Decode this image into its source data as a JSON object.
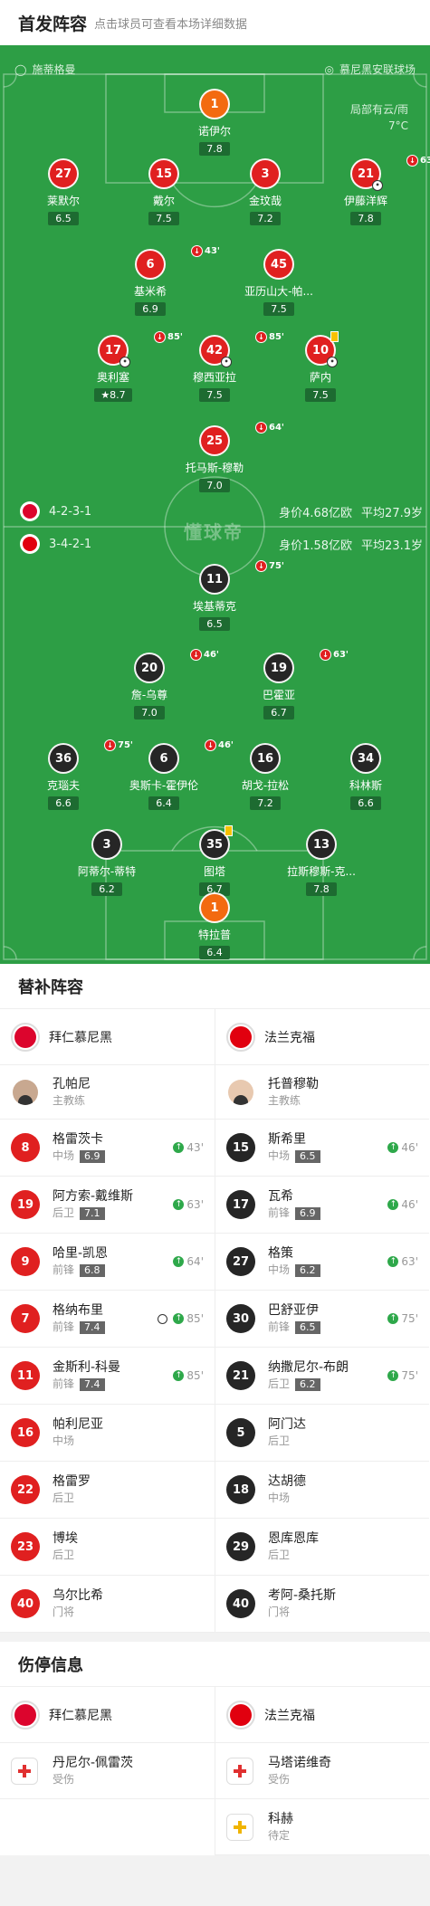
{
  "header": {
    "title": "首发阵容",
    "subtitle": "点击球员可查看本场详细数据"
  },
  "pitch": {
    "home_venue": "施蒂格曼",
    "away_venue": "慕尼黑安联球场",
    "weather": [
      "局部有云/雨",
      "7°C"
    ],
    "watermark": "懂球帝",
    "home": {
      "formation": "4-2-3-1",
      "value": "身价4.68亿欧",
      "age": "平均27.9岁",
      "color": "#dc052d"
    },
    "away": {
      "formation": "3-4-2-1",
      "value": "身价1.58亿欧",
      "age": "平均23.1岁",
      "color": "#e1000f"
    },
    "players": [
      {
        "num": "1",
        "name": "诺伊尔",
        "rating": "7.8",
        "style": "org"
      },
      {
        "num": "27",
        "name": "莱默尔",
        "rating": "6.5",
        "style": "red"
      },
      {
        "num": "15",
        "name": "戴尔",
        "rating": "7.5",
        "style": "red"
      },
      {
        "num": "3",
        "name": "金玟哉",
        "rating": "7.2",
        "style": "red"
      },
      {
        "num": "21",
        "name": "伊藤洋辉",
        "rating": "7.8",
        "style": "red",
        "sub": "63'",
        "ball": true
      },
      {
        "num": "6",
        "name": "基米希",
        "rating": "6.9",
        "style": "red",
        "sub": "43'"
      },
      {
        "num": "45",
        "name": "亚历山大-帕...",
        "rating": "7.5",
        "style": "red"
      },
      {
        "num": "17",
        "name": "奥利塞",
        "rating": "8.7",
        "style": "red",
        "sub": "85'",
        "ball": true,
        "star": true
      },
      {
        "num": "42",
        "name": "穆西亚拉",
        "rating": "7.5",
        "style": "red",
        "sub": "85'",
        "ball": true
      },
      {
        "num": "10",
        "name": "萨内",
        "rating": "7.5",
        "style": "red",
        "yellow": true,
        "ball": true
      },
      {
        "num": "25",
        "name": "托马斯-穆勒",
        "rating": "7.0",
        "style": "red",
        "sub": "64'"
      },
      {
        "num": "11",
        "name": "埃基蒂克",
        "rating": "6.5",
        "style": "blk",
        "sub": "75'"
      },
      {
        "num": "20",
        "name": "詹-乌尊",
        "rating": "7.0",
        "style": "blk",
        "sub": "46'"
      },
      {
        "num": "19",
        "name": "巴霍亚",
        "rating": "6.7",
        "style": "blk",
        "sub": "63'"
      },
      {
        "num": "36",
        "name": "克瑙夫",
        "rating": "6.6",
        "style": "blk",
        "sub": "75'"
      },
      {
        "num": "6",
        "name": "奥斯卡-霍伊伦",
        "rating": "6.4",
        "style": "blk",
        "sub": "46'"
      },
      {
        "num": "16",
        "name": "胡戈-拉松",
        "rating": "7.2",
        "style": "blk"
      },
      {
        "num": "34",
        "name": "科林斯",
        "rating": "6.6",
        "style": "blk"
      },
      {
        "num": "3",
        "name": "阿蒂尔-蒂特",
        "rating": "6.2",
        "style": "blk"
      },
      {
        "num": "35",
        "name": "图塔",
        "rating": "6.7",
        "style": "blk",
        "yellow": true
      },
      {
        "num": "13",
        "name": "拉斯穆斯-克...",
        "rating": "7.8",
        "style": "blk"
      },
      {
        "num": "1",
        "name": "特拉普",
        "rating": "6.4",
        "style": "org"
      }
    ]
  },
  "subs": {
    "title": "替补阵容",
    "home": {
      "team": "拜仁慕尼黑",
      "coach": {
        "name": "孔帕尼",
        "role": "主教练"
      },
      "players": [
        {
          "num": "8",
          "name": "格雷茨卡",
          "pos": "中场",
          "rating": "6.9",
          "min": "43'"
        },
        {
          "num": "19",
          "name": "阿方索-戴维斯",
          "pos": "后卫",
          "rating": "7.1",
          "min": "63'"
        },
        {
          "num": "9",
          "name": "哈里-凯恩",
          "pos": "前锋",
          "rating": "6.8",
          "min": "64'"
        },
        {
          "num": "7",
          "name": "格纳布里",
          "pos": "前锋",
          "rating": "7.4",
          "min": "85'",
          "ball": true
        },
        {
          "num": "11",
          "name": "金斯利-科曼",
          "pos": "前锋",
          "rating": "7.4",
          "min": "85'"
        },
        {
          "num": "16",
          "name": "帕利尼亚",
          "pos": "中场"
        },
        {
          "num": "22",
          "name": "格雷罗",
          "pos": "后卫"
        },
        {
          "num": "23",
          "name": "博埃",
          "pos": "后卫"
        },
        {
          "num": "40",
          "name": "乌尔比希",
          "pos": "门将"
        }
      ]
    },
    "away": {
      "team": "法兰克福",
      "coach": {
        "name": "托普穆勒",
        "role": "主教练"
      },
      "players": [
        {
          "num": "15",
          "name": "斯希里",
          "pos": "中场",
          "rating": "6.5",
          "min": "46'"
        },
        {
          "num": "17",
          "name": "瓦希",
          "pos": "前锋",
          "rating": "6.9",
          "min": "46'"
        },
        {
          "num": "27",
          "name": "格策",
          "pos": "中场",
          "rating": "6.2",
          "min": "63'"
        },
        {
          "num": "30",
          "name": "巴舒亚伊",
          "pos": "前锋",
          "rating": "6.5",
          "min": "75'"
        },
        {
          "num": "21",
          "name": "纳撒尼尔-布朗",
          "pos": "后卫",
          "rating": "6.2",
          "min": "75'"
        },
        {
          "num": "5",
          "name": "阿门达",
          "pos": "后卫"
        },
        {
          "num": "18",
          "name": "达胡德",
          "pos": "中场"
        },
        {
          "num": "29",
          "name": "恩库恩库",
          "pos": "后卫"
        },
        {
          "num": "40",
          "name": "考阿-桑托斯",
          "pos": "门将"
        }
      ]
    }
  },
  "injury": {
    "title": "伤停信息",
    "home": {
      "team": "拜仁慕尼黑",
      "players": [
        {
          "name": "丹尼尔-佩雷茨",
          "status": "受伤",
          "icon": "red"
        }
      ]
    },
    "away": {
      "team": "法兰克福",
      "players": [
        {
          "name": "马塔诺维奇",
          "status": "受伤",
          "icon": "red"
        },
        {
          "name": "科赫",
          "status": "待定",
          "icon": "yellow"
        }
      ]
    }
  }
}
